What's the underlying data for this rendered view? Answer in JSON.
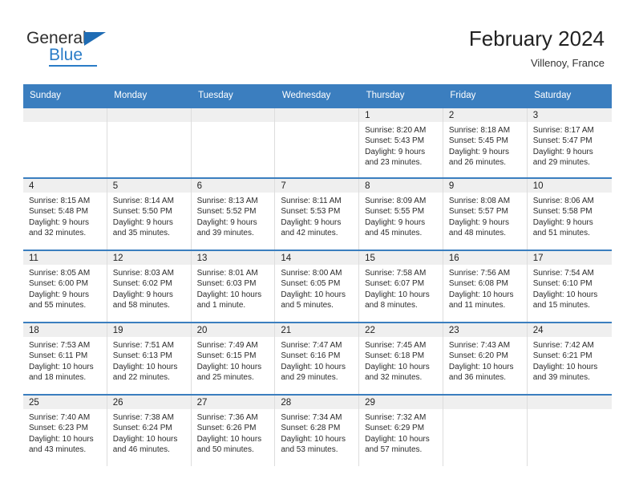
{
  "brand": {
    "name_top": "General",
    "name_bottom": "Blue"
  },
  "header": {
    "title": "February 2024",
    "location": "Villenoy, France"
  },
  "colors": {
    "header_blue": "#3b7ebf",
    "brand_blue": "#2a7cc7",
    "daynum_band": "#efefef"
  },
  "weekday_headers": [
    "Sunday",
    "Monday",
    "Tuesday",
    "Wednesday",
    "Thursday",
    "Friday",
    "Saturday"
  ],
  "weeks": [
    [
      {
        "day": "",
        "sunrise": "",
        "sunset": "",
        "daylight_line1": "",
        "daylight_line2": ""
      },
      {
        "day": "",
        "sunrise": "",
        "sunset": "",
        "daylight_line1": "",
        "daylight_line2": ""
      },
      {
        "day": "",
        "sunrise": "",
        "sunset": "",
        "daylight_line1": "",
        "daylight_line2": ""
      },
      {
        "day": "",
        "sunrise": "",
        "sunset": "",
        "daylight_line1": "",
        "daylight_line2": ""
      },
      {
        "day": "1",
        "sunrise": "Sunrise: 8:20 AM",
        "sunset": "Sunset: 5:43 PM",
        "daylight_line1": "Daylight: 9 hours",
        "daylight_line2": "and 23 minutes."
      },
      {
        "day": "2",
        "sunrise": "Sunrise: 8:18 AM",
        "sunset": "Sunset: 5:45 PM",
        "daylight_line1": "Daylight: 9 hours",
        "daylight_line2": "and 26 minutes."
      },
      {
        "day": "3",
        "sunrise": "Sunrise: 8:17 AM",
        "sunset": "Sunset: 5:47 PM",
        "daylight_line1": "Daylight: 9 hours",
        "daylight_line2": "and 29 minutes."
      }
    ],
    [
      {
        "day": "4",
        "sunrise": "Sunrise: 8:15 AM",
        "sunset": "Sunset: 5:48 PM",
        "daylight_line1": "Daylight: 9 hours",
        "daylight_line2": "and 32 minutes."
      },
      {
        "day": "5",
        "sunrise": "Sunrise: 8:14 AM",
        "sunset": "Sunset: 5:50 PM",
        "daylight_line1": "Daylight: 9 hours",
        "daylight_line2": "and 35 minutes."
      },
      {
        "day": "6",
        "sunrise": "Sunrise: 8:13 AM",
        "sunset": "Sunset: 5:52 PM",
        "daylight_line1": "Daylight: 9 hours",
        "daylight_line2": "and 39 minutes."
      },
      {
        "day": "7",
        "sunrise": "Sunrise: 8:11 AM",
        "sunset": "Sunset: 5:53 PM",
        "daylight_line1": "Daylight: 9 hours",
        "daylight_line2": "and 42 minutes."
      },
      {
        "day": "8",
        "sunrise": "Sunrise: 8:09 AM",
        "sunset": "Sunset: 5:55 PM",
        "daylight_line1": "Daylight: 9 hours",
        "daylight_line2": "and 45 minutes."
      },
      {
        "day": "9",
        "sunrise": "Sunrise: 8:08 AM",
        "sunset": "Sunset: 5:57 PM",
        "daylight_line1": "Daylight: 9 hours",
        "daylight_line2": "and 48 minutes."
      },
      {
        "day": "10",
        "sunrise": "Sunrise: 8:06 AM",
        "sunset": "Sunset: 5:58 PM",
        "daylight_line1": "Daylight: 9 hours",
        "daylight_line2": "and 51 minutes."
      }
    ],
    [
      {
        "day": "11",
        "sunrise": "Sunrise: 8:05 AM",
        "sunset": "Sunset: 6:00 PM",
        "daylight_line1": "Daylight: 9 hours",
        "daylight_line2": "and 55 minutes."
      },
      {
        "day": "12",
        "sunrise": "Sunrise: 8:03 AM",
        "sunset": "Sunset: 6:02 PM",
        "daylight_line1": "Daylight: 9 hours",
        "daylight_line2": "and 58 minutes."
      },
      {
        "day": "13",
        "sunrise": "Sunrise: 8:01 AM",
        "sunset": "Sunset: 6:03 PM",
        "daylight_line1": "Daylight: 10 hours",
        "daylight_line2": "and 1 minute."
      },
      {
        "day": "14",
        "sunrise": "Sunrise: 8:00 AM",
        "sunset": "Sunset: 6:05 PM",
        "daylight_line1": "Daylight: 10 hours",
        "daylight_line2": "and 5 minutes."
      },
      {
        "day": "15",
        "sunrise": "Sunrise: 7:58 AM",
        "sunset": "Sunset: 6:07 PM",
        "daylight_line1": "Daylight: 10 hours",
        "daylight_line2": "and 8 minutes."
      },
      {
        "day": "16",
        "sunrise": "Sunrise: 7:56 AM",
        "sunset": "Sunset: 6:08 PM",
        "daylight_line1": "Daylight: 10 hours",
        "daylight_line2": "and 11 minutes."
      },
      {
        "day": "17",
        "sunrise": "Sunrise: 7:54 AM",
        "sunset": "Sunset: 6:10 PM",
        "daylight_line1": "Daylight: 10 hours",
        "daylight_line2": "and 15 minutes."
      }
    ],
    [
      {
        "day": "18",
        "sunrise": "Sunrise: 7:53 AM",
        "sunset": "Sunset: 6:11 PM",
        "daylight_line1": "Daylight: 10 hours",
        "daylight_line2": "and 18 minutes."
      },
      {
        "day": "19",
        "sunrise": "Sunrise: 7:51 AM",
        "sunset": "Sunset: 6:13 PM",
        "daylight_line1": "Daylight: 10 hours",
        "daylight_line2": "and 22 minutes."
      },
      {
        "day": "20",
        "sunrise": "Sunrise: 7:49 AM",
        "sunset": "Sunset: 6:15 PM",
        "daylight_line1": "Daylight: 10 hours",
        "daylight_line2": "and 25 minutes."
      },
      {
        "day": "21",
        "sunrise": "Sunrise: 7:47 AM",
        "sunset": "Sunset: 6:16 PM",
        "daylight_line1": "Daylight: 10 hours",
        "daylight_line2": "and 29 minutes."
      },
      {
        "day": "22",
        "sunrise": "Sunrise: 7:45 AM",
        "sunset": "Sunset: 6:18 PM",
        "daylight_line1": "Daylight: 10 hours",
        "daylight_line2": "and 32 minutes."
      },
      {
        "day": "23",
        "sunrise": "Sunrise: 7:43 AM",
        "sunset": "Sunset: 6:20 PM",
        "daylight_line1": "Daylight: 10 hours",
        "daylight_line2": "and 36 minutes."
      },
      {
        "day": "24",
        "sunrise": "Sunrise: 7:42 AM",
        "sunset": "Sunset: 6:21 PM",
        "daylight_line1": "Daylight: 10 hours",
        "daylight_line2": "and 39 minutes."
      }
    ],
    [
      {
        "day": "25",
        "sunrise": "Sunrise: 7:40 AM",
        "sunset": "Sunset: 6:23 PM",
        "daylight_line1": "Daylight: 10 hours",
        "daylight_line2": "and 43 minutes."
      },
      {
        "day": "26",
        "sunrise": "Sunrise: 7:38 AM",
        "sunset": "Sunset: 6:24 PM",
        "daylight_line1": "Daylight: 10 hours",
        "daylight_line2": "and 46 minutes."
      },
      {
        "day": "27",
        "sunrise": "Sunrise: 7:36 AM",
        "sunset": "Sunset: 6:26 PM",
        "daylight_line1": "Daylight: 10 hours",
        "daylight_line2": "and 50 minutes."
      },
      {
        "day": "28",
        "sunrise": "Sunrise: 7:34 AM",
        "sunset": "Sunset: 6:28 PM",
        "daylight_line1": "Daylight: 10 hours",
        "daylight_line2": "and 53 minutes."
      },
      {
        "day": "29",
        "sunrise": "Sunrise: 7:32 AM",
        "sunset": "Sunset: 6:29 PM",
        "daylight_line1": "Daylight: 10 hours",
        "daylight_line2": "and 57 minutes."
      },
      {
        "day": "",
        "sunrise": "",
        "sunset": "",
        "daylight_line1": "",
        "daylight_line2": ""
      },
      {
        "day": "",
        "sunrise": "",
        "sunset": "",
        "daylight_line1": "",
        "daylight_line2": ""
      }
    ]
  ]
}
